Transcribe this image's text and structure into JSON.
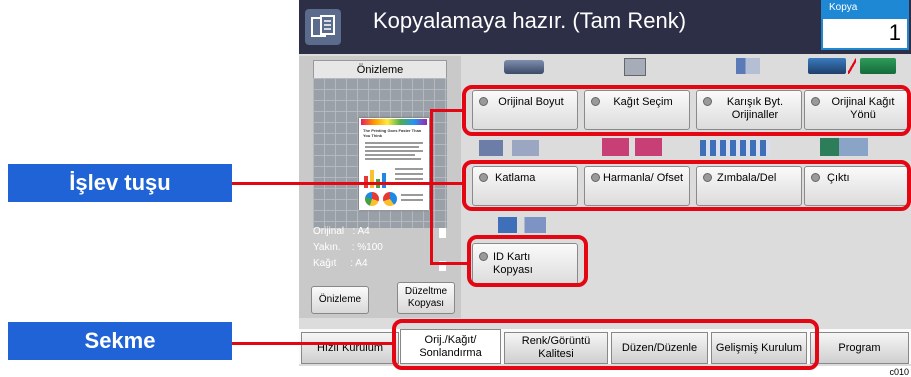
{
  "callouts": {
    "function_key": "İşlev tuşu",
    "tab": "Sekme"
  },
  "status_bar": {
    "title": "Kopyalamaya hazır. (Tam Renk)",
    "copies_label": "Kopya",
    "copies_value": "1"
  },
  "preview": {
    "header": "Önizleme",
    "doc_heading": "The Printing Goes Faster Than You Think",
    "info": [
      {
        "label": "Orijinal",
        "value": ": A4"
      },
      {
        "label": "Yakın.",
        "value": ": %100"
      },
      {
        "label": "Kağıt",
        "value": ": A4"
      }
    ],
    "preview_button": "Önizleme",
    "edit_copy_button": "Düzeltme Kopyası"
  },
  "functions": {
    "row1": [
      {
        "label": "Orijinal Boyut"
      },
      {
        "label": "Kağıt Seçim"
      },
      {
        "label": "Karışık Byt. Orijinaller"
      },
      {
        "label": "Orijinal Kağıt Yönü"
      }
    ],
    "row2": [
      {
        "label": "Katlama"
      },
      {
        "label": "Harmanla/ Ofset"
      },
      {
        "label": "Zımbala/Del"
      },
      {
        "label": "Çıktı"
      }
    ],
    "row3": [
      {
        "label": "ID Kartı Kopyası"
      }
    ]
  },
  "tabs": [
    {
      "label": "Hızlı Kurulum"
    },
    {
      "label": "Orij./Kağıt/ Sonlandırma"
    },
    {
      "label": "Renk/Görüntü Kalitesi"
    },
    {
      "label": "Düzen/Düzenle"
    },
    {
      "label": "Gelişmiş Kurulum"
    },
    {
      "label": "Program"
    }
  ],
  "image_code": "c010",
  "colors": {
    "callout_bg": "#1f63d6",
    "highlight": "#e30613",
    "title_bar": "#2c2f46",
    "copies_accent": "#1e88d4"
  }
}
